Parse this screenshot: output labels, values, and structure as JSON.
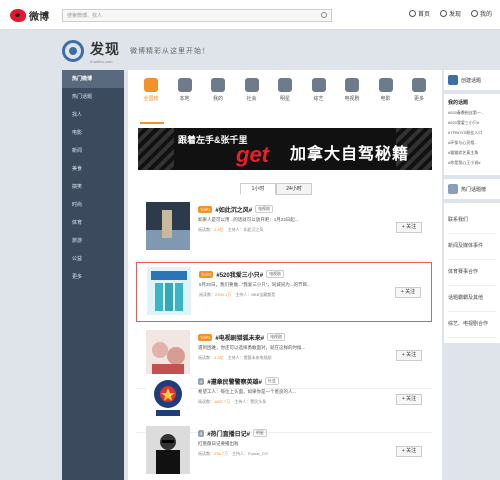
{
  "topbar": {
    "brand": "微博",
    "search_placeholder": "搜索微博、找人",
    "links": [
      "首页",
      "发现",
      "我的"
    ]
  },
  "header": {
    "title": "发现",
    "subtitle": "d.weibo.com",
    "slogan": "微博精彩从这里开始！"
  },
  "leftnav": [
    "热门微博",
    "热门话题",
    "找人",
    "电影",
    "新闻",
    "美食",
    "搞笑",
    "时尚",
    "体育",
    "旅游",
    "公益",
    "更多"
  ],
  "categories": [
    "全国榜",
    "本地",
    "我的",
    "社会",
    "明星",
    "综艺",
    "电视剧",
    "电影",
    "更多"
  ],
  "banner": {
    "text1": "跟着左手&张千里",
    "text2": "get",
    "text3": "加拿大自驾秘籍"
  },
  "tabs": [
    "1小时",
    "24小时"
  ],
  "topics": [
    {
      "rank": "TOP1",
      "title": "#如此沉之风#",
      "category": "电视剧",
      "desc": "如果人是可以用...的话就可以放开吧：1月23日起...",
      "views_label": "阅读数：",
      "views": "2.4亿",
      "host": "主持人：如此沉之风"
    },
    {
      "rank": "TOP2",
      "title": "#520我爱三小只#",
      "category": "电视剧",
      "desc": "5月20日，我们要做...“我爱三小只”，同城同为...的节目...",
      "views_label": "阅读数：",
      "views": "2300.1万",
      "host": "主持人：BBB宝藏都是"
    },
    {
      "rank": "TOP3",
      "title": "#电视剧猎狐未来#",
      "category": "电视剧",
      "desc": "遇到困难，你还可以选择勇敢面对，就在这样的时候...",
      "views_label": "阅读数：",
      "views": "3.3亿",
      "host": "主持人：猎狐未来电视剧"
    },
    {
      "rank": "4",
      "title": "#遵章民警警察英雄#",
      "category": "社会",
      "desc": "希望工人：每位上头面，如果你是一个善良的人...",
      "views_label": "阅读数：",
      "views": "1867.7万",
      "host": "主持人：警民头条"
    },
    {
      "rank": "5",
      "title": "#热门直播日记#",
      "category": "明星",
      "desc": "红蔷薇日记要播出啦",
      "views_label": "阅读数：",
      "views": "236.7万",
      "host": "主持人：Pumat_DIY"
    }
  ],
  "follow_label": "+ 关注",
  "right": {
    "create_btn": "创建话题",
    "my_topics": "我的话题",
    "my_topic_list": [
      "#520春晚粉丝第一...",
      "#520我爱三小只#",
      "#TFBOYS粉丝入口",
      "#环保与心灵相...",
      "#猫猫综艺真主角",
      "#你是我心王小说#"
    ],
    "hot_btn": "热门话题榜",
    "links": [
      "联系我们",
      "新闻及媒体事件",
      "体育赛事合作",
      "话题霸霸及其他",
      "综艺、电视剧合作"
    ]
  },
  "colors": {
    "accent": "#f29329",
    "brand_red": "#e6162d",
    "nav_bg": "#3b4a5c",
    "highlight": "#e35b5b"
  }
}
